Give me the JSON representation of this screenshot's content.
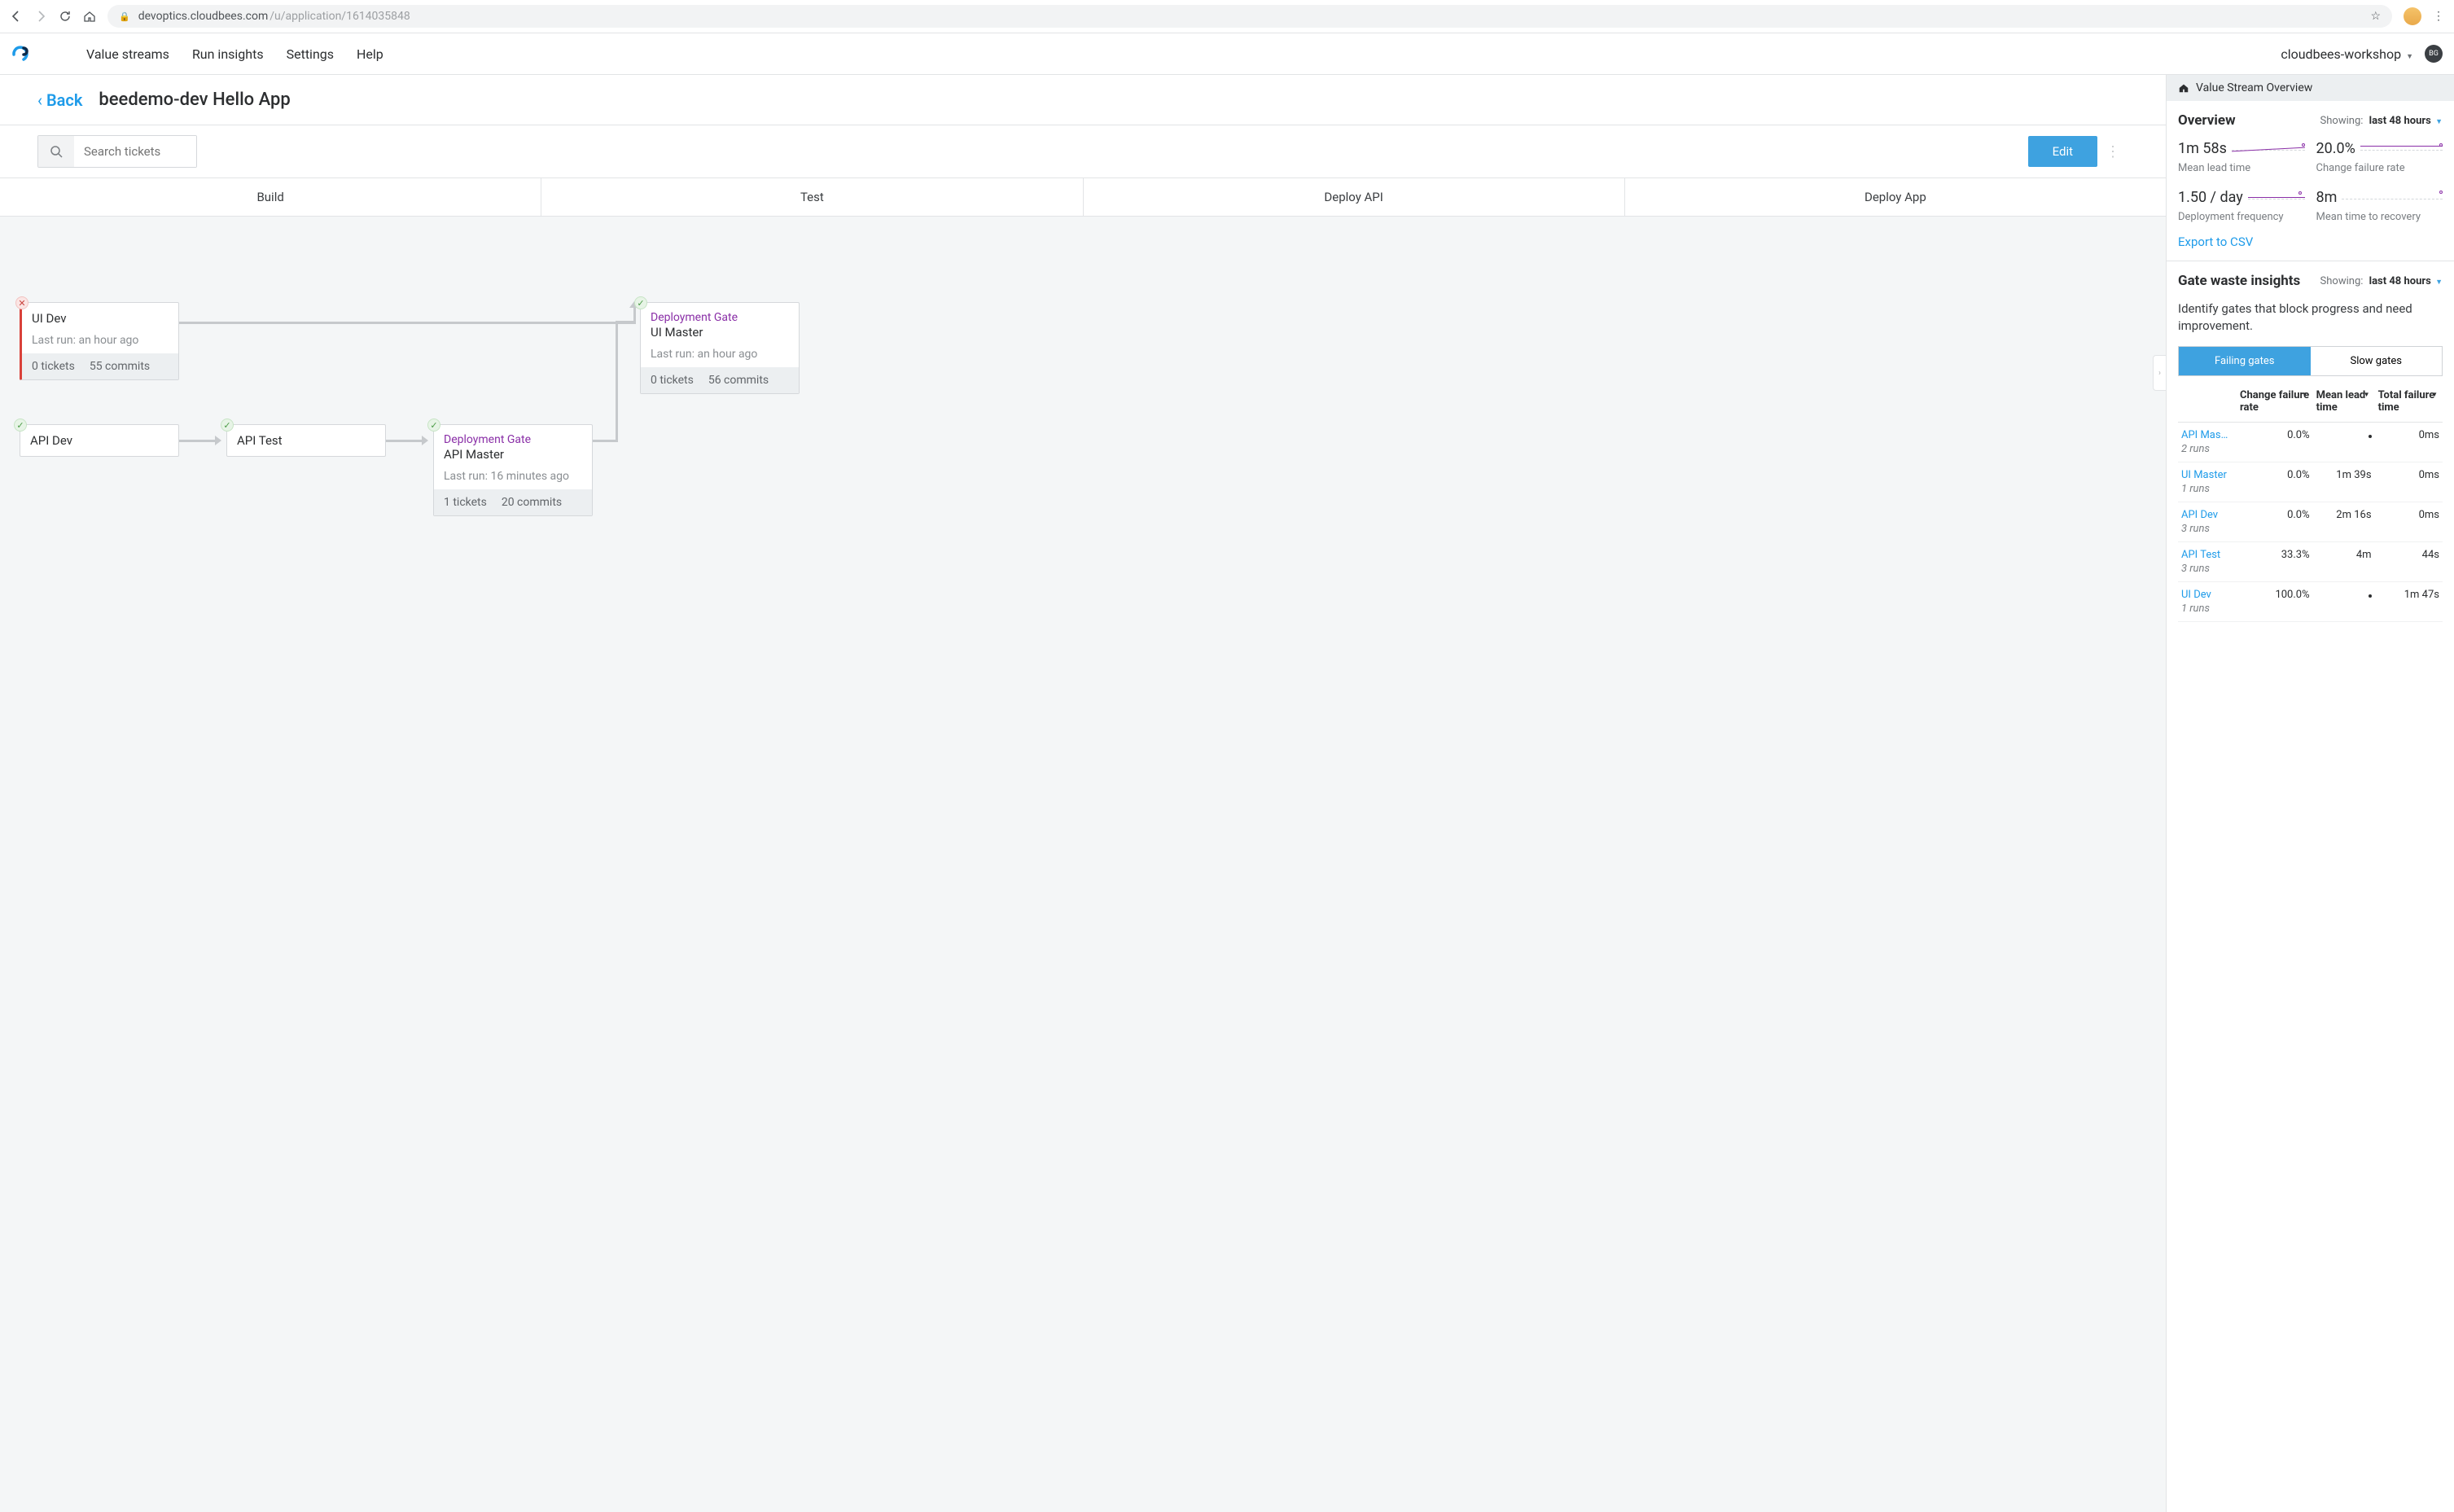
{
  "browser": {
    "url_host": "devoptics.cloudbees.com",
    "url_path": "/u/application/1614035848"
  },
  "header": {
    "nav": [
      "Value streams",
      "Run insights",
      "Settings",
      "Help"
    ],
    "workspace": "cloudbees-workshop",
    "user_initials": "BG"
  },
  "page": {
    "back": "Back",
    "title": "beedemo-dev Hello App",
    "search_placeholder": "Search tickets",
    "edit_btn": "Edit",
    "stages": [
      "Build",
      "Test",
      "Deploy API",
      "Deploy App"
    ]
  },
  "cards": {
    "ui_dev": {
      "name": "UI Dev",
      "last_run": "Last run: an hour ago",
      "tickets": "0 tickets",
      "commits": "55 commits"
    },
    "api_dev": {
      "name": "API Dev"
    },
    "api_test": {
      "name": "API Test"
    },
    "api_master": {
      "gate": "Deployment Gate",
      "name": "API Master",
      "last_run": "Last run: 16 minutes ago",
      "tickets": "1 tickets",
      "commits": "20 commits"
    },
    "ui_master": {
      "gate": "Deployment Gate",
      "name": "UI Master",
      "last_run": "Last run: an hour ago",
      "tickets": "0 tickets",
      "commits": "56 commits"
    }
  },
  "side": {
    "breadcrumb": "Value Stream Overview",
    "overview": {
      "title": "Overview",
      "showing_label": "Showing:",
      "showing_value": "last 48 hours",
      "m1_v": "1m 58s",
      "m1_l": "Mean lead time",
      "m2_v": "20.0%",
      "m2_l": "Change failure rate",
      "m3_v": "1.50 / day",
      "m3_l": "Deployment frequency",
      "m4_v": "8m",
      "m4_l": "Mean time to recovery",
      "export": "Export to CSV"
    },
    "gates": {
      "title": "Gate waste insights",
      "showing_label": "Showing:",
      "showing_value": "last 48 hours",
      "desc": "Identify gates that block progress and need improvement.",
      "tab_failing": "Failing gates",
      "tab_slow": "Slow gates",
      "col1": "Change failure rate",
      "col2": "Mean lead time",
      "col3": "Total failure time",
      "rows": [
        {
          "name": "API Mas…",
          "runs": "2 runs",
          "cfr": "0.0%",
          "mlt": "•",
          "tft": "0ms"
        },
        {
          "name": "UI Master",
          "runs": "1 runs",
          "cfr": "0.0%",
          "mlt": "1m 39s",
          "tft": "0ms"
        },
        {
          "name": "API Dev",
          "runs": "3 runs",
          "cfr": "0.0%",
          "mlt": "2m 16s",
          "tft": "0ms"
        },
        {
          "name": "API Test",
          "runs": "3 runs",
          "cfr": "33.3%",
          "mlt": "4m",
          "tft": "44s"
        },
        {
          "name": "UI Dev",
          "runs": "1 runs",
          "cfr": "100.0%",
          "mlt": "•",
          "tft": "1m 47s"
        }
      ]
    }
  }
}
